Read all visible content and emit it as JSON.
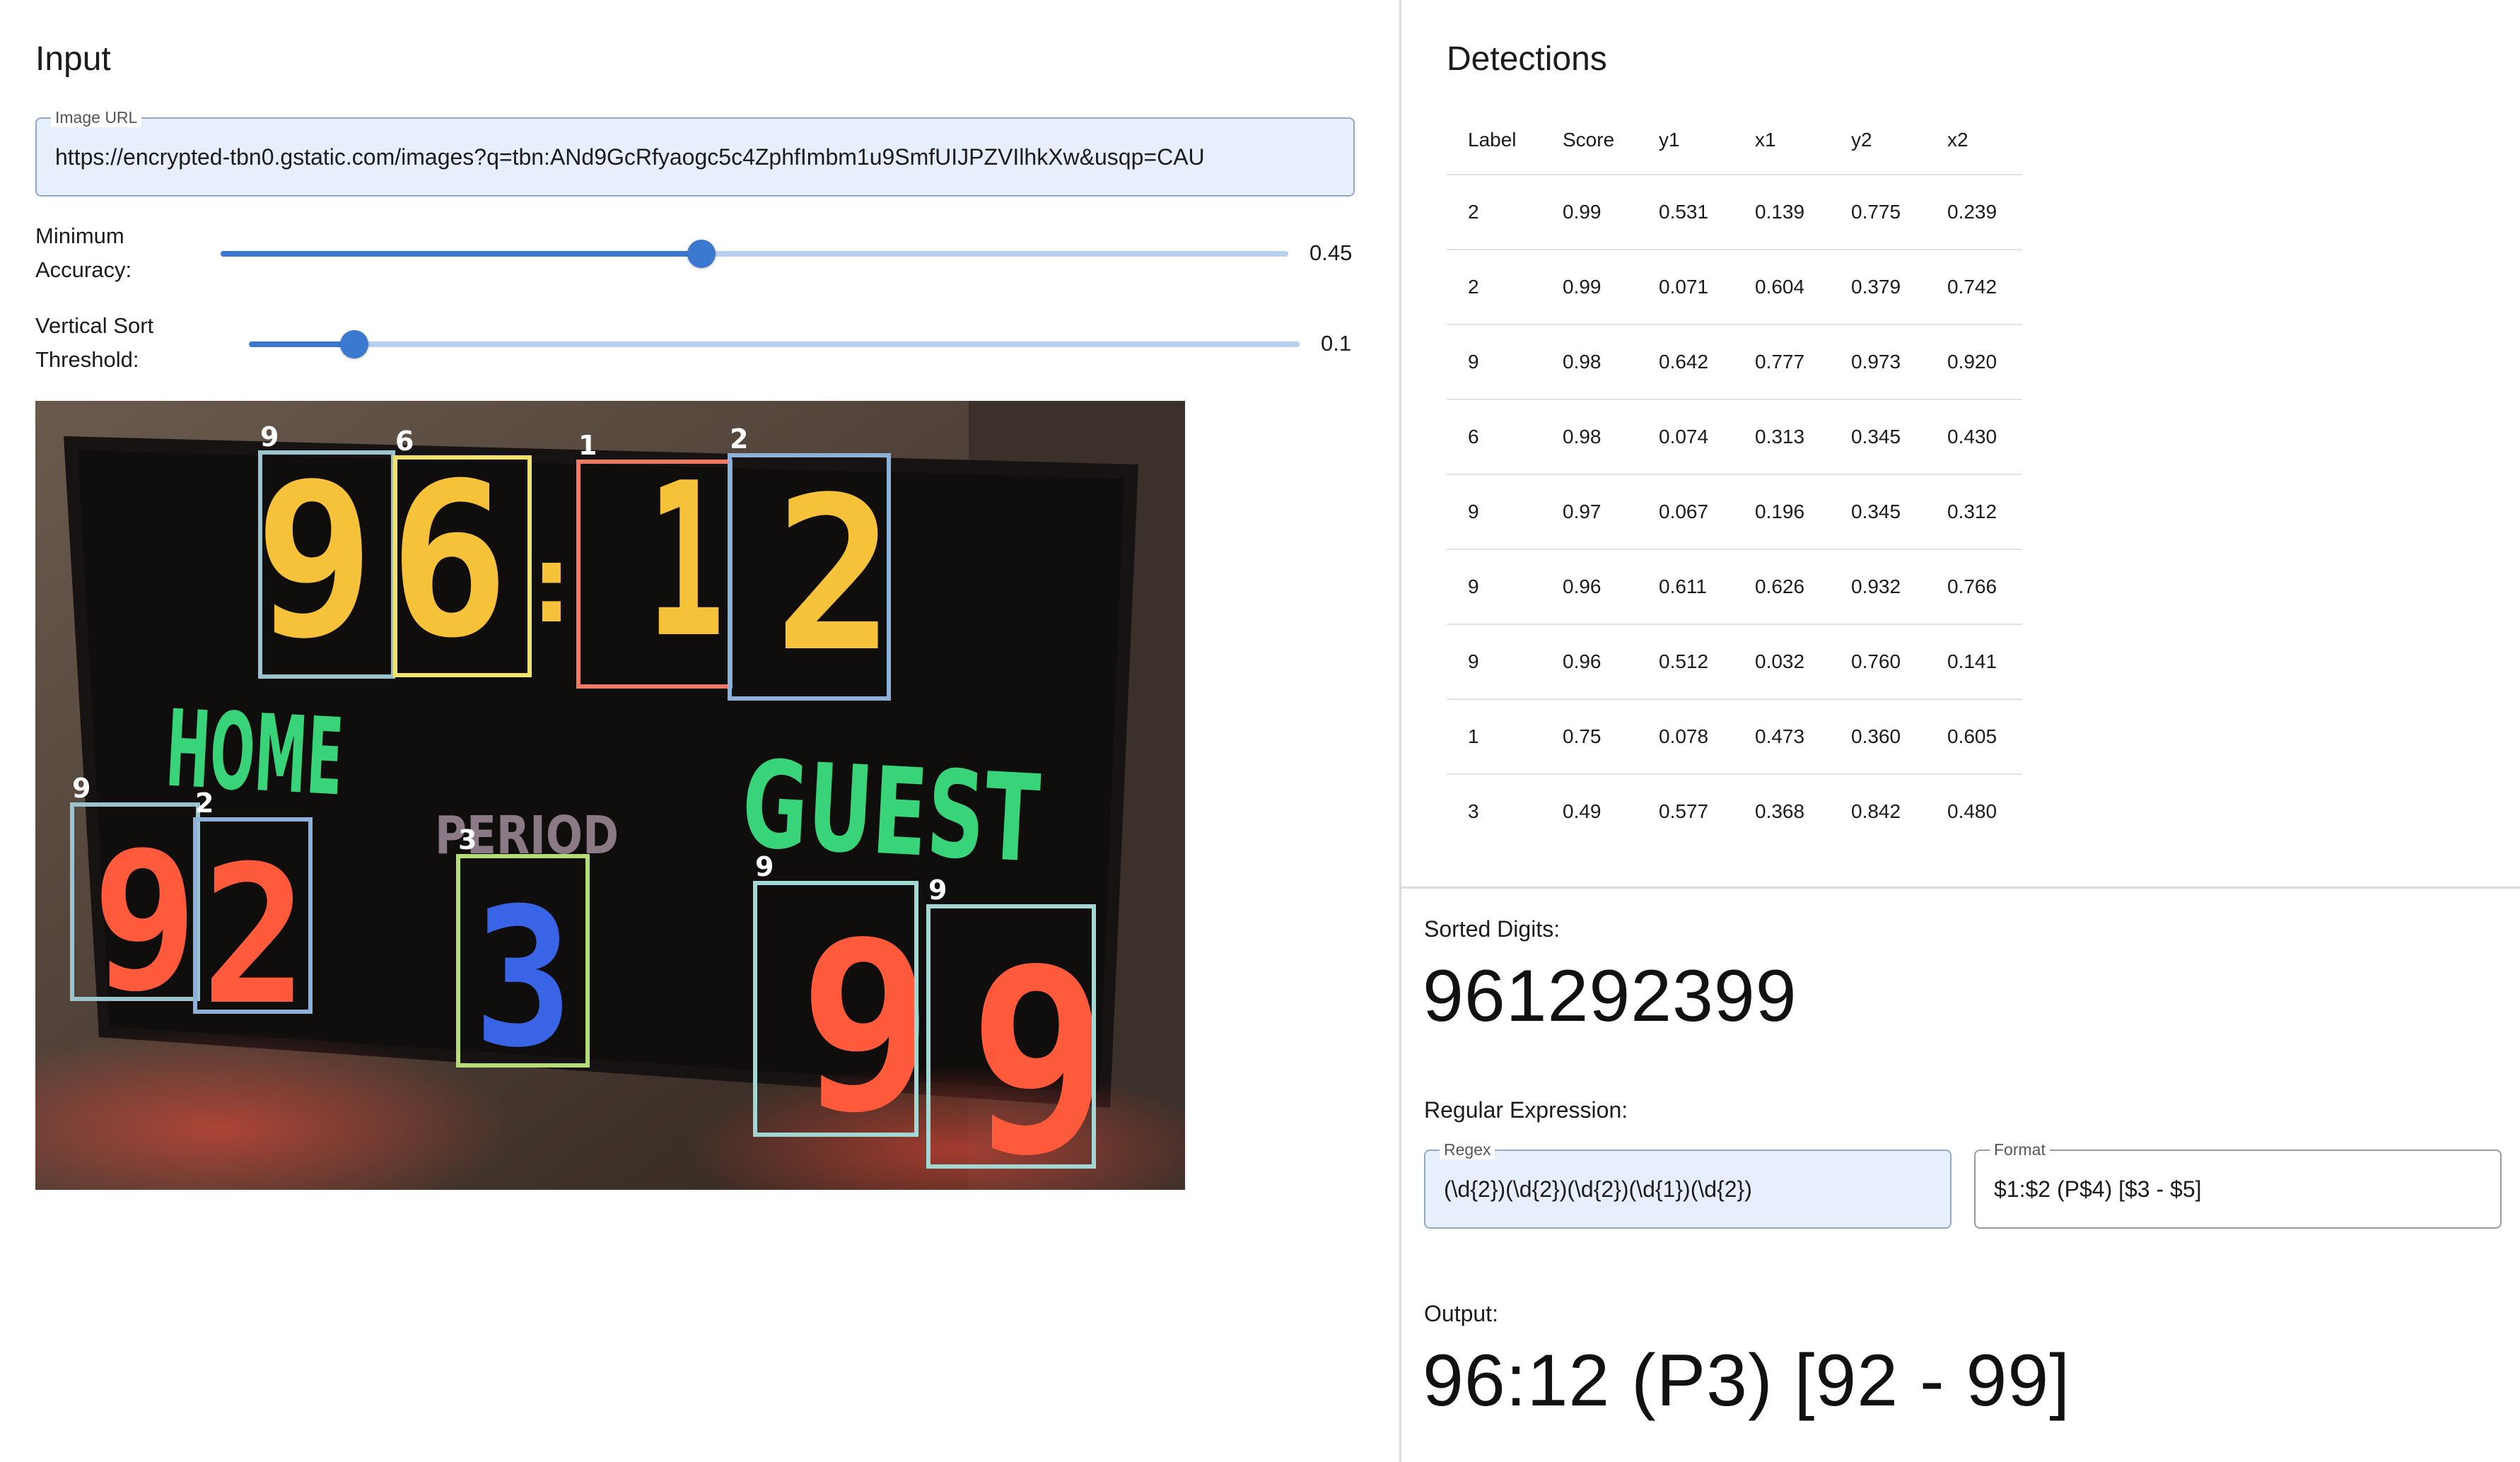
{
  "input": {
    "title": "Input",
    "image_url": {
      "label": "Image URL",
      "value": "https://encrypted-tbn0.gstatic.com/images?q=tbn:ANd9GcRfyaogc5c4ZphfImbm1u9SmfUIJPZVIlhkXw&usqp=CAU"
    },
    "min_accuracy": {
      "label_line1": "Minimum",
      "label_line2": "Accuracy:",
      "value": "0.45",
      "fraction": 0.45
    },
    "vertical_sort": {
      "label_line1": "Vertical Sort",
      "label_line2": "Threshold:",
      "value": "0.1",
      "fraction": 0.1
    },
    "image": {
      "scene_text": {
        "home": "HOME",
        "guest": "GUEST",
        "period": "PERIOD"
      },
      "box_labels": [
        "9",
        "6",
        "1",
        "2",
        "9",
        "2",
        "3",
        "9",
        "9"
      ]
    }
  },
  "detections": {
    "title": "Detections",
    "columns": [
      "Label",
      "Score",
      "y1",
      "x1",
      "y2",
      "x2"
    ],
    "rows": [
      [
        "2",
        "0.99",
        "0.531",
        "0.139",
        "0.775",
        "0.239"
      ],
      [
        "2",
        "0.99",
        "0.071",
        "0.604",
        "0.379",
        "0.742"
      ],
      [
        "9",
        "0.98",
        "0.642",
        "0.777",
        "0.973",
        "0.920"
      ],
      [
        "6",
        "0.98",
        "0.074",
        "0.313",
        "0.345",
        "0.430"
      ],
      [
        "9",
        "0.97",
        "0.067",
        "0.196",
        "0.345",
        "0.312"
      ],
      [
        "9",
        "0.96",
        "0.611",
        "0.626",
        "0.932",
        "0.766"
      ],
      [
        "9",
        "0.96",
        "0.512",
        "0.032",
        "0.760",
        "0.141"
      ],
      [
        "1",
        "0.75",
        "0.078",
        "0.473",
        "0.360",
        "0.605"
      ],
      [
        "3",
        "0.49",
        "0.577",
        "0.368",
        "0.842",
        "0.480"
      ]
    ]
  },
  "sorted_digits": {
    "label": "Sorted Digits:",
    "value": "961292399"
  },
  "regex": {
    "label": "Regular Expression:",
    "regex_field": {
      "label": "Regex",
      "value": "(\\d{2})(\\d{2})(\\d{2})(\\d{1})(\\d{2})"
    },
    "format_field": {
      "label": "Format",
      "value": "$1:$2 (P$4) [$3 - $5]"
    }
  },
  "output": {
    "label": "Output:",
    "value": "96:12 (P3) [92 - 99]"
  },
  "colors": {
    "accent": "#3b78cf",
    "track": "#b9cfee",
    "field_bg": "#e8effc"
  }
}
